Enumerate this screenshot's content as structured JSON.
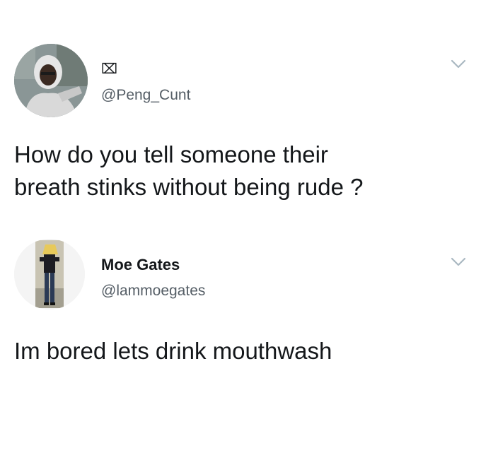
{
  "tweets": [
    {
      "display_name": "⌧",
      "handle": "@Peng_Cunt",
      "text": "How do you tell someone their\nbreath stinks without being rude ?",
      "avatar_icon": "user-avatar-hooded-man",
      "menu_icon": "chevron-down-icon"
    },
    {
      "display_name": "Moe Gates",
      "handle": "@lammoegates",
      "text": "Im bored lets drink mouthwash",
      "avatar_icon": "user-avatar-standing-man",
      "menu_icon": "chevron-down-icon"
    }
  ],
  "colors": {
    "text": "#14171a",
    "handle": "#555e66",
    "chevron": "#aab8c2",
    "background": "#ffffff"
  }
}
